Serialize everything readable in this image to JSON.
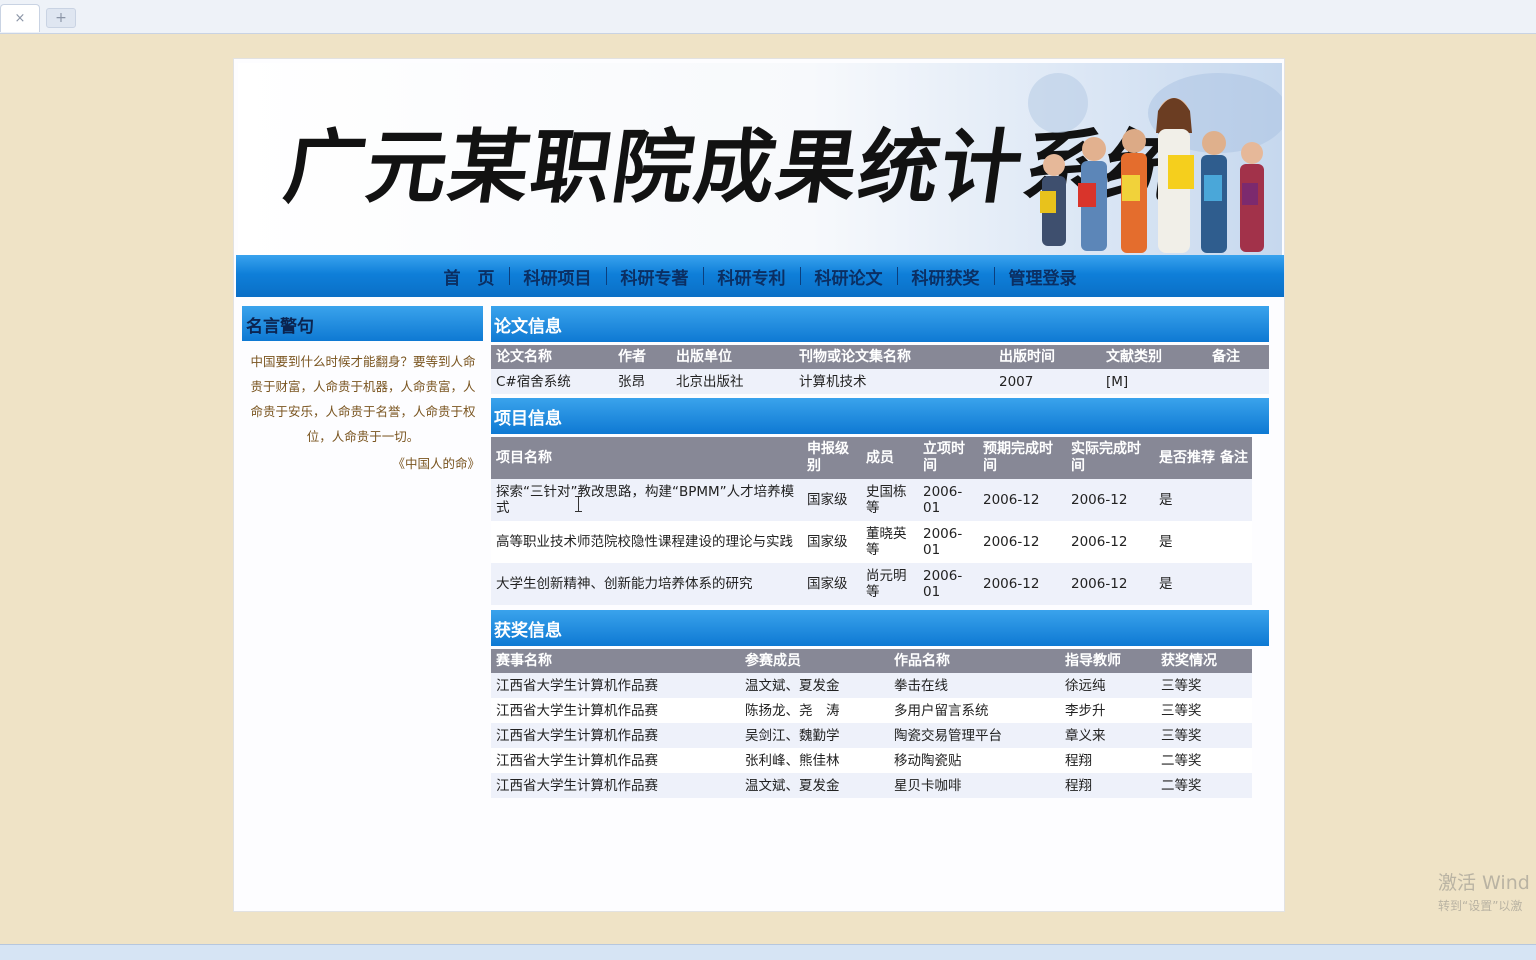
{
  "browser": {
    "close_glyph": "×",
    "new_tab_glyph": "+"
  },
  "banner": {
    "title": "广元某职院成果统计系统"
  },
  "nav": {
    "items": [
      "首　页",
      "科研项目",
      "科研专著",
      "科研专利",
      "科研论文",
      "科研获奖",
      "管理登录"
    ]
  },
  "sidebar": {
    "title": "名言警句",
    "quote": "中国要到什么时候才能翻身？要等到人命贵于财富，人命贵于机器，人命贵富，人命贵于安乐，人命贵于名誉，人命贵于权位，人命贵于一切。",
    "source": "《中国人的命》"
  },
  "papers": {
    "title": "论文信息",
    "headers": [
      "论文名称",
      "作者",
      "出版单位",
      "刊物或论文集名称",
      "出版时间",
      "文献类别",
      "备注"
    ],
    "rows": [
      [
        "C#宿舍系统",
        "张昂",
        "北京出版社",
        "计算机技术",
        "2007",
        "[M]",
        ""
      ]
    ]
  },
  "projects": {
    "title": "项目信息",
    "headers": [
      "项目名称",
      "申报级别",
      "成员",
      "立项时间",
      "预期完成时间",
      "实际完成时间",
      "是否推荐",
      "备注"
    ],
    "rows": [
      [
        "探索“三针对”教改思路，构建“BPMM”人才培养模式",
        "国家级",
        "史国栋等",
        "2006-01",
        "2006-12",
        "2006-12",
        "是",
        ""
      ],
      [
        "高等职业技术师范院校隐性课程建设的理论与实践",
        "国家级",
        "董晓英等",
        "2006-01",
        "2006-12",
        "2006-12",
        "是",
        ""
      ],
      [
        "大学生创新精神、创新能力培养体系的研究",
        "国家级",
        "尚元明等",
        "2006-01",
        "2006-12",
        "2006-12",
        "是",
        ""
      ]
    ]
  },
  "awards": {
    "title": "获奖信息",
    "headers": [
      "赛事名称",
      "参赛成员",
      "作品名称",
      "指导教师",
      "获奖情况"
    ],
    "rows": [
      [
        "江西省大学生计算机作品赛",
        "温文斌、夏发金",
        "拳击在线",
        "徐远纯",
        "三等奖"
      ],
      [
        "江西省大学生计算机作品赛",
        "陈扬龙、尧　涛",
        "多用户留言系统",
        "李步升",
        "三等奖"
      ],
      [
        "江西省大学生计算机作品赛",
        "吴剑江、魏勤学",
        "陶瓷交易管理平台",
        "章义来",
        "三等奖"
      ],
      [
        "江西省大学生计算机作品赛",
        "张利峰、熊佳林",
        "移动陶瓷贴",
        "程翔",
        "二等奖"
      ],
      [
        "江西省大学生计算机作品赛",
        "温文斌、夏发金",
        "星贝卡咖啡",
        "程翔",
        "二等奖"
      ]
    ]
  },
  "os_watermark": {
    "line1": "激活 Wind",
    "line2": "转到“设置”以激"
  }
}
